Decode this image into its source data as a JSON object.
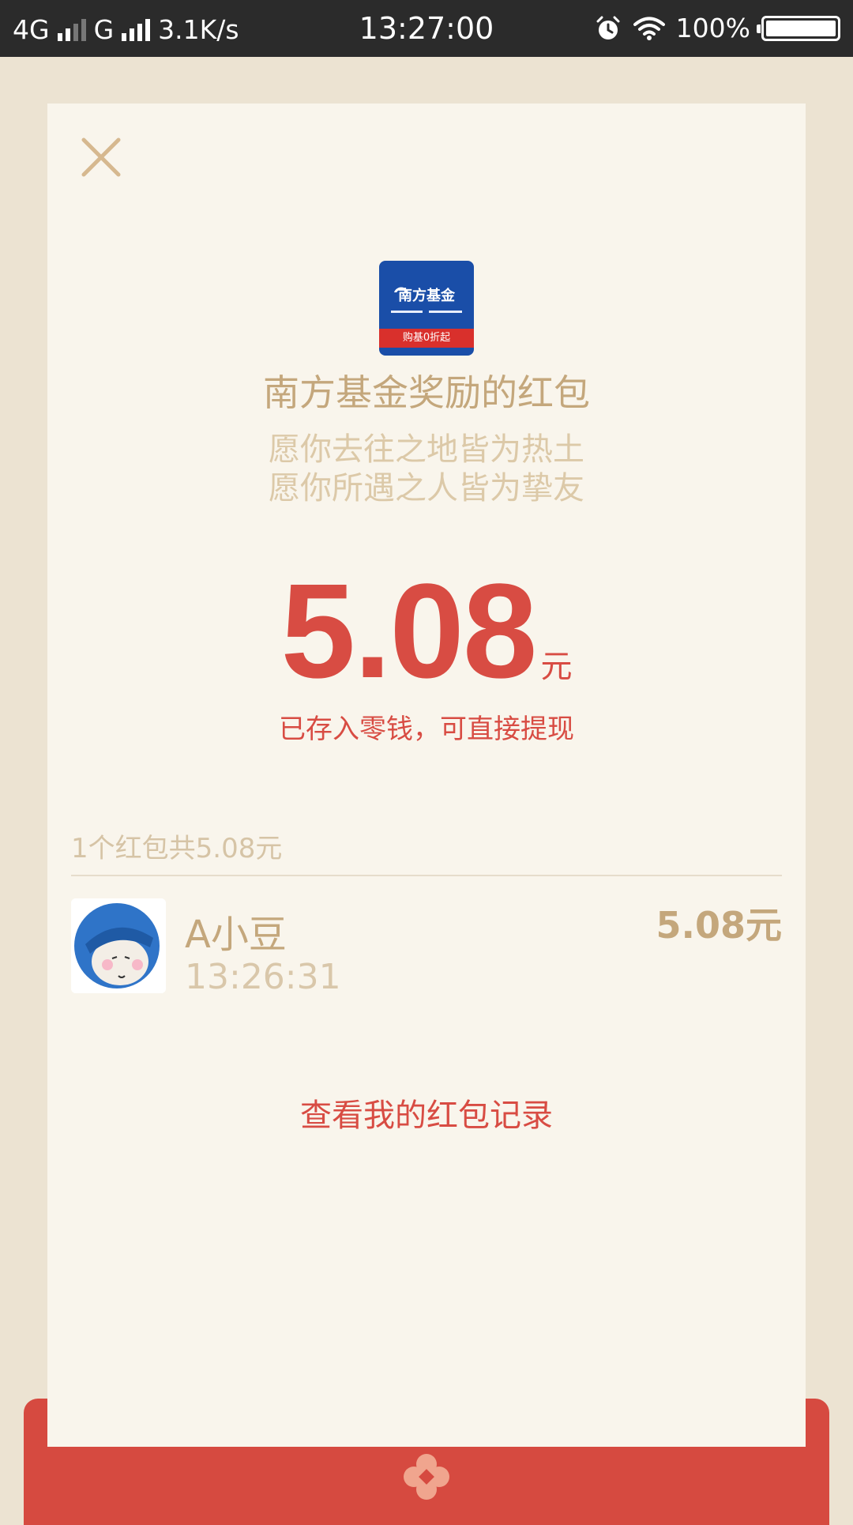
{
  "status_bar": {
    "network1": "4G",
    "network2": "G",
    "speed": "3.1K/s",
    "time": "13:27:00",
    "battery": "100%"
  },
  "envelope": {
    "close_icon": "close-icon",
    "logo": {
      "name": "南方基金",
      "ribbon": "购基0折起"
    },
    "title": "南方基金奖励的红包",
    "wish_line1": "愿你去往之地皆为热土",
    "wish_line2": "愿你所遇之人皆为挚友",
    "amount": "5.08",
    "unit": "元",
    "saved_note": "已存入零钱，可直接提现"
  },
  "receivers": {
    "summary": "1个红包共5.08元",
    "items": [
      {
        "name": "A小豆",
        "time": "13:26:31",
        "amount": "5.08元"
      }
    ]
  },
  "actions": {
    "history_link": "查看我的红包记录"
  },
  "colors": {
    "accent_red": "#d84c43",
    "gold_text": "#c4a77c",
    "card_bg": "#f9f5ec",
    "page_bg": "#ece3d2"
  }
}
